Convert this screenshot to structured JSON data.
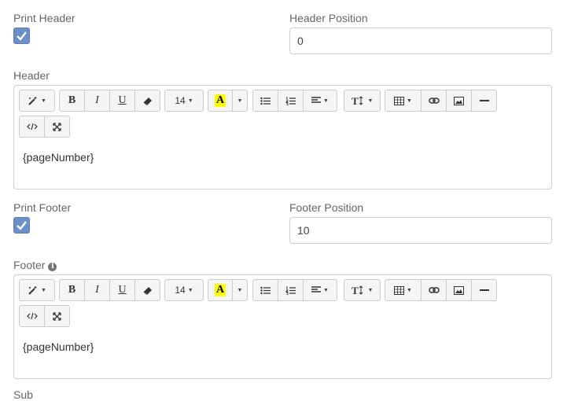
{
  "header_section": {
    "print_label": "Print Header",
    "print_checked": true,
    "position_label": "Header Position",
    "position_value": "0",
    "editor_label": "Header",
    "content": "{pageNumber}"
  },
  "footer_section": {
    "print_label": "Print Footer",
    "print_checked": true,
    "position_label": "Footer Position",
    "position_value": "10",
    "editor_label": "Footer",
    "content": "{pageNumber}"
  },
  "toolbar": {
    "style_icon": "magic-wand-icon",
    "bold": "B",
    "italic": "I",
    "underline": "U",
    "font_size": "14",
    "highlight": "A",
    "highlight_color": "#ffff00"
  },
  "next_label_partial": "Sub"
}
